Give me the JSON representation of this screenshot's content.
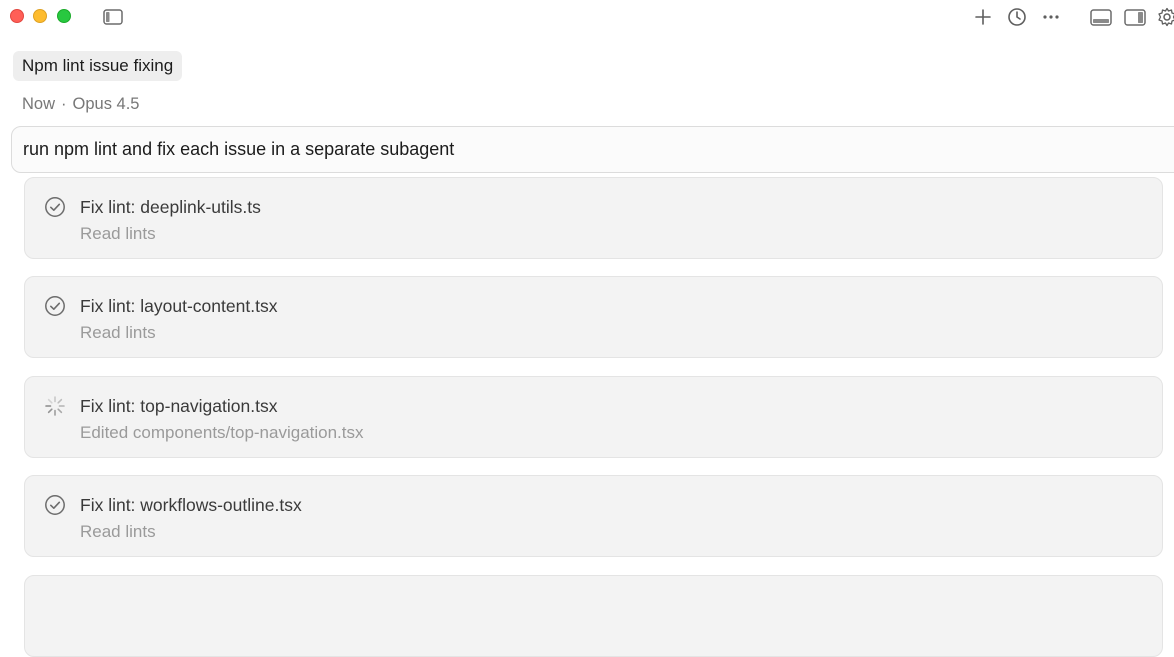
{
  "window": {
    "controls": [
      "close",
      "minimize",
      "zoom"
    ],
    "icons": [
      "sidebar-toggle-icon",
      "plus-icon",
      "history-icon",
      "more-icon",
      "bottom-panel-icon",
      "right-panel-icon",
      "gear-icon"
    ]
  },
  "chat": {
    "title": "Npm lint issue fixing",
    "meta_time": "Now",
    "meta_separator": "·",
    "meta_model": "Opus 4.5",
    "prompt": "run npm lint and fix each issue in a separate subagent"
  },
  "tasks": [
    {
      "title": "Fix lint: deeplink-utils.ts",
      "subtitle": "Read lints",
      "status": "done"
    },
    {
      "title": "Fix lint: layout-content.tsx",
      "subtitle": "Read lints",
      "status": "done"
    },
    {
      "title": "Fix lint: top-navigation.tsx",
      "subtitle": "Edited components/top-navigation.tsx",
      "status": "in-progress"
    },
    {
      "title": "Fix lint: workflows-outline.tsx",
      "subtitle": "Read lints",
      "status": "done"
    }
  ]
}
